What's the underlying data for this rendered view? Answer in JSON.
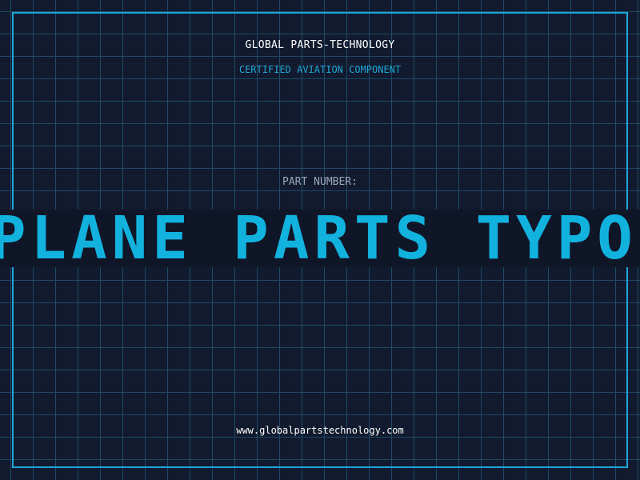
{
  "header": {
    "company": "GLOBAL PARTS-TECHNOLOGY",
    "subtitle": "CERTIFIED AVIATION COMPONENT"
  },
  "part": {
    "label": "PART NUMBER:",
    "number": "PLANE PARTS TYPOGRA"
  },
  "footer": {
    "website": "www.globalpartstechnology.com"
  },
  "colors": {
    "background": "#111a2e",
    "grid": "#1e4a66",
    "accent": "#1da7d8",
    "text": "#ffffff",
    "muted": "#9aa8bc"
  }
}
